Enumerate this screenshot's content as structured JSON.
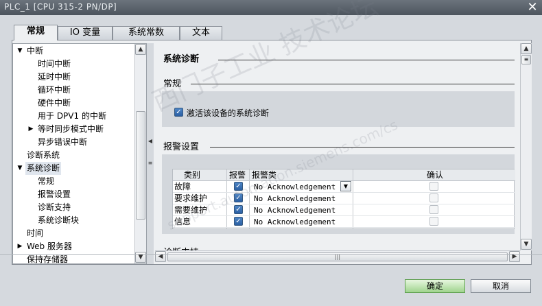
{
  "window": {
    "title": "PLC_1 [CPU 315-2 PN/DP]",
    "close_glyph": "✕"
  },
  "tabs": [
    "常规",
    "IO 变量",
    "系统常数",
    "文本"
  ],
  "tree": {
    "items": [
      {
        "label": "中断",
        "arrow": "▼"
      },
      {
        "label": "时间中断",
        "arrow": ""
      },
      {
        "label": "延时中断",
        "arrow": ""
      },
      {
        "label": "循环中断",
        "arrow": ""
      },
      {
        "label": "硬件中断",
        "arrow": ""
      },
      {
        "label": "用于 DPV1 的中断",
        "arrow": ""
      },
      {
        "label": "等时同步模式中断",
        "arrow": "▶"
      },
      {
        "label": "异步错误中断",
        "arrow": ""
      },
      {
        "label": "诊断系统",
        "arrow": ""
      },
      {
        "label": "系统诊断",
        "arrow": "▼"
      },
      {
        "label": "常规",
        "arrow": ""
      },
      {
        "label": "报警设置",
        "arrow": ""
      },
      {
        "label": "诊断支持",
        "arrow": ""
      },
      {
        "label": "系统诊断块",
        "arrow": ""
      },
      {
        "label": "时间",
        "arrow": ""
      },
      {
        "label": "Web 服务器",
        "arrow": "▶"
      },
      {
        "label": "保持存储器",
        "arrow": ""
      }
    ]
  },
  "pane": {
    "section_title": "系统诊断",
    "general_title": "常规",
    "enable_checkbox_label": "激活该设备的系统诊断",
    "alarm_title": "报警设置",
    "diag_support_title": "诊断支持",
    "grid": {
      "headers": [
        "类别",
        "报警",
        "报警类",
        "确认"
      ],
      "rows": [
        {
          "category": "故障",
          "alarm": true,
          "alarm_class": "No Acknowledgement",
          "confirm": false
        },
        {
          "category": "要求维护",
          "alarm": true,
          "alarm_class": "No Acknowledgement",
          "confirm": false
        },
        {
          "category": "需要维护",
          "alarm": true,
          "alarm_class": "No Acknowledgement",
          "confirm": false
        },
        {
          "category": "信息",
          "alarm": true,
          "alarm_class": "No Acknowledgement",
          "confirm": false
        }
      ]
    }
  },
  "buttons": {
    "ok": "确定",
    "cancel": "取消"
  },
  "watermark": {
    "line1": "西门子工业 技术论坛",
    "line2": "support.automation.siemens.com/cs"
  },
  "colors": {
    "ok_button": "#9fd48e",
    "checkbox": "#2a5fa3"
  }
}
